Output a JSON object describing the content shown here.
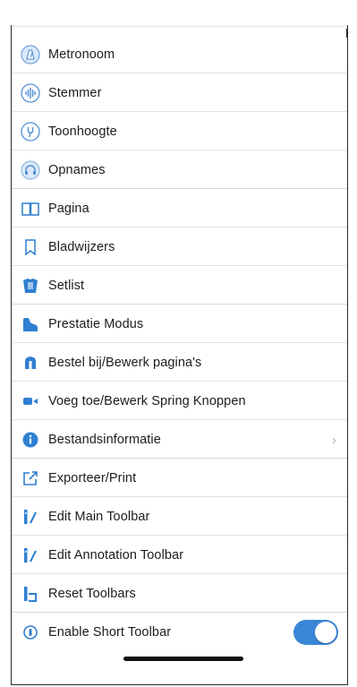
{
  "menu": {
    "items": [
      {
        "label": "Metronoom",
        "icon": "metronome-icon"
      },
      {
        "label": "Stemmer",
        "icon": "tuner-icon"
      },
      {
        "label": "Toonhoogte",
        "icon": "pitch-fork-icon"
      },
      {
        "label": "Opnames",
        "icon": "headphones-icon"
      },
      {
        "label": "Pagina",
        "icon": "book-icon"
      },
      {
        "label": "Bladwijzers",
        "icon": "bookmark-icon"
      },
      {
        "label": "Setlist",
        "icon": "setlist-icon"
      },
      {
        "label": "Prestatie Modus",
        "icon": "piano-icon"
      },
      {
        "label": "Bestel bij/Bewerk pagina's",
        "icon": "reorder-pages-icon"
      },
      {
        "label": "Voeg toe/Bewerk Spring Knoppen",
        "icon": "jump-button-icon"
      },
      {
        "label": "Bestandsinformatie",
        "icon": "info-icon",
        "chevron": "›"
      },
      {
        "label": "Exporteer/Print",
        "icon": "export-icon"
      },
      {
        "label": "Edit Main Toolbar",
        "icon": "edit-toolbar-icon"
      },
      {
        "label": "Edit Annotation Toolbar",
        "icon": "edit-toolbar-icon"
      },
      {
        "label": "Reset Toolbars",
        "icon": "reset-icon"
      },
      {
        "label": "Enable Short Toolbar",
        "icon": "short-toolbar-icon",
        "toggle_on": true
      }
    ]
  },
  "colors": {
    "accent": "#3a86d6",
    "toggle_on": "#3a86d6",
    "separator": "#e2e2e2"
  }
}
